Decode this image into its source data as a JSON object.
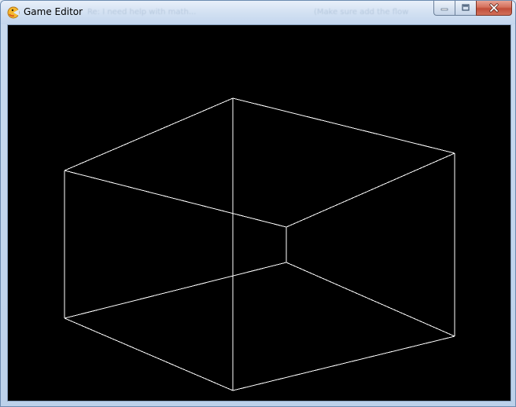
{
  "window": {
    "title": "Game Editor",
    "buttons": {
      "minimize": "minimize",
      "maximize": "maximize",
      "close": "close"
    }
  },
  "background_titles": {
    "left": "Re: I need help with math... ",
    "right": "(Make sure add the flow"
  },
  "canvas": {
    "background_color": "#000000",
    "line_color": "#ffffff",
    "shape": "wireframe-cube"
  },
  "icons": {
    "app": "game-editor-app-icon",
    "minimize": "minimize-icon",
    "maximize": "maximize-icon",
    "close": "close-icon"
  }
}
